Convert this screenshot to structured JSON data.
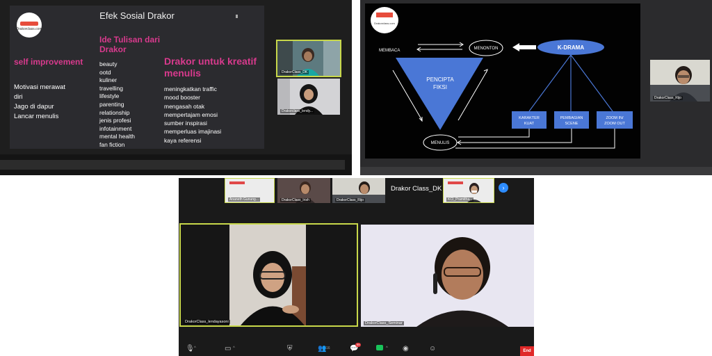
{
  "colors": {
    "accent_pink": "#d83a8d",
    "kdrama_blue": "#4a77d6",
    "speaker_border": "#c8d84a",
    "zoom_blue": "#2d8cff",
    "end_red": "#e02828"
  },
  "panel1": {
    "slide": {
      "title": "Efek Sosial Drakor",
      "logo_text": "Drakorclass.com",
      "heading_ide": "Ide Tulisan dari Drakor",
      "heading_self": "self improvement",
      "heading_drakor": "Drakor untuk kreatif menulis",
      "self_items": [
        "Motivasi merawat",
        "diri",
        "Jago di dapur",
        "Lancar menulis"
      ],
      "ide_items": [
        "beauty",
        "ootd",
        "kuliner",
        "travelling",
        "lifestyle",
        "parenting",
        "relationship",
        "jenis profesi",
        "infotainment",
        "mental health",
        "fan fiction"
      ],
      "drakor_items": [
        "meningkatkan traffic",
        "mood booster",
        "mengasah otak",
        "mempertajam emosi",
        "sumber inspirasi",
        "memperluas imajinasi",
        "kaya referensi"
      ]
    },
    "thumbnails": [
      {
        "label": "DrakorClass_DK"
      },
      {
        "label": "Drakorclass_lendy..."
      }
    ]
  },
  "panel2": {
    "diagram": {
      "logo_text": "Drakorclass.com",
      "membaca": "MEMBACA",
      "menonton": "MENONTON",
      "kdrama": "K-DRAMA",
      "pencipta": [
        "PENCIPTA",
        "FIKSI"
      ],
      "menulis": "MENULIS",
      "boxes": [
        [
          "KARAKTER",
          "KUAT"
        ],
        [
          "PEMBAGIAN",
          "SCENE"
        ],
        [
          "ZOOM IN/",
          "ZOOM OUT"
        ]
      ]
    },
    "thumbnail": {
      "label": "DrakorClass_Rijo"
    }
  },
  "panel3": {
    "meeting_name": "Drakor Class_DK",
    "strip_thumbs": [
      {
        "label": "Ananeth Gunung..."
      },
      {
        "label": "DrakorClass_Irish"
      },
      {
        "label": "DrakorClass_Rijo"
      },
      {
        "label": "KCI_Pramitha..."
      }
    ],
    "videos": {
      "left": {
        "label": "DrakorClass_lendayasoni"
      },
      "right": {
        "label": "DrakorClass_Seminar"
      }
    },
    "toolbar": {
      "chat_badge": "99",
      "participants_count": "16",
      "end_label": "End"
    }
  }
}
